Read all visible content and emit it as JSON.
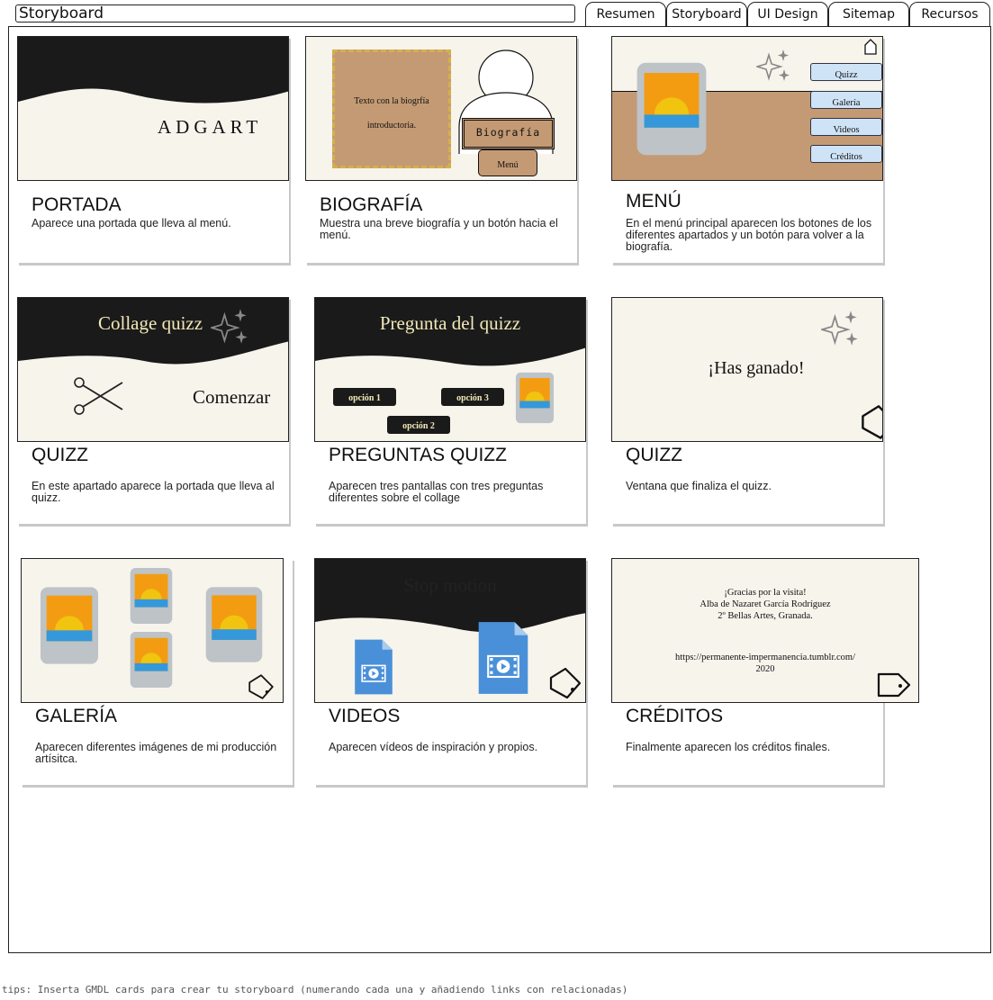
{
  "header": {
    "title": "Storyboard",
    "tabs": [
      {
        "label": "Resumen",
        "active": false
      },
      {
        "label": "Storyboard",
        "active": true
      },
      {
        "label": "UI Design",
        "active": false
      },
      {
        "label": "Sitemap",
        "active": false
      },
      {
        "label": "Recursos",
        "active": false
      }
    ]
  },
  "colors": {
    "dark": "#1a1a1a",
    "cream": "#f7f4ec",
    "tan": "#c49a74",
    "gold": "#d4b04a",
    "button_blue": "#cfe3f7",
    "quiz_title": "#f3e9b8",
    "image_orange": "#f39c12",
    "image_sun": "#f1c40f",
    "image_water": "#3498db",
    "frame_gray": "#bdc3c7",
    "video_blue": "#4a90d9"
  },
  "cards": [
    {
      "heading": "PORTADA",
      "description": "Aparece una portada que lleva al menú.",
      "screen": {
        "logo_text": "ADGART"
      }
    },
    {
      "heading": "BIOGRAFÍA",
      "description": "Muestra una breve biografía y un botón hacia el menú.",
      "screen": {
        "text_box_line1": "Texto con la biogrfía",
        "text_box_line2": "introductoria.",
        "name_label": "Biografía",
        "menu_button": "Menú"
      }
    },
    {
      "heading": "MENÚ",
      "description": "En el menú principal aparecen los botones de los diferentes apartados y un botón para volver a la biografía.",
      "screen": {
        "buttons": [
          "Quizz",
          "Galería",
          "Videos",
          "Créditos"
        ]
      }
    },
    {
      "heading": "QUIZZ",
      "description": "En este apartado aparece la portada que lleva al quizz.",
      "screen": {
        "title": "Collage quizz",
        "start": "Comenzar"
      }
    },
    {
      "heading": "PREGUNTAS QUIZZ",
      "description": "Aparecen tres pantallas con tres preguntas diferentes sobre el collage",
      "screen": {
        "title": "Pregunta del quizz",
        "options": [
          "opción 1",
          "opción 3",
          "opción 2"
        ]
      }
    },
    {
      "heading": "QUIZZ",
      "description": "Ventana que finaliza el quizz.",
      "screen": {
        "message": "¡Has ganado!"
      }
    },
    {
      "heading": "GALERÍA",
      "description": "Aparecen diferentes imágenes de mi producción artísitca.",
      "screen": {}
    },
    {
      "heading": "VIDEOS",
      "description": "Aparecen vídeos de inspiración y propios.",
      "screen": {
        "title": "Stop motion"
      }
    },
    {
      "heading": "CRÉDITOS",
      "description": "Finalmente aparecen los créditos finales.",
      "screen": {
        "line1": "¡Gracias por la visita!",
        "line2": "Alba de Nazaret García Rodríguez",
        "line3": "2º Bellas Artes, Granada.",
        "url": "https://permanente-impermanencia.tumblr.com/",
        "year": "2020"
      }
    }
  ],
  "footer": {
    "tips": "tips: Inserta GMDL cards para crear tu storyboard (numerando cada una y añadiendo links con relacionadas)"
  }
}
